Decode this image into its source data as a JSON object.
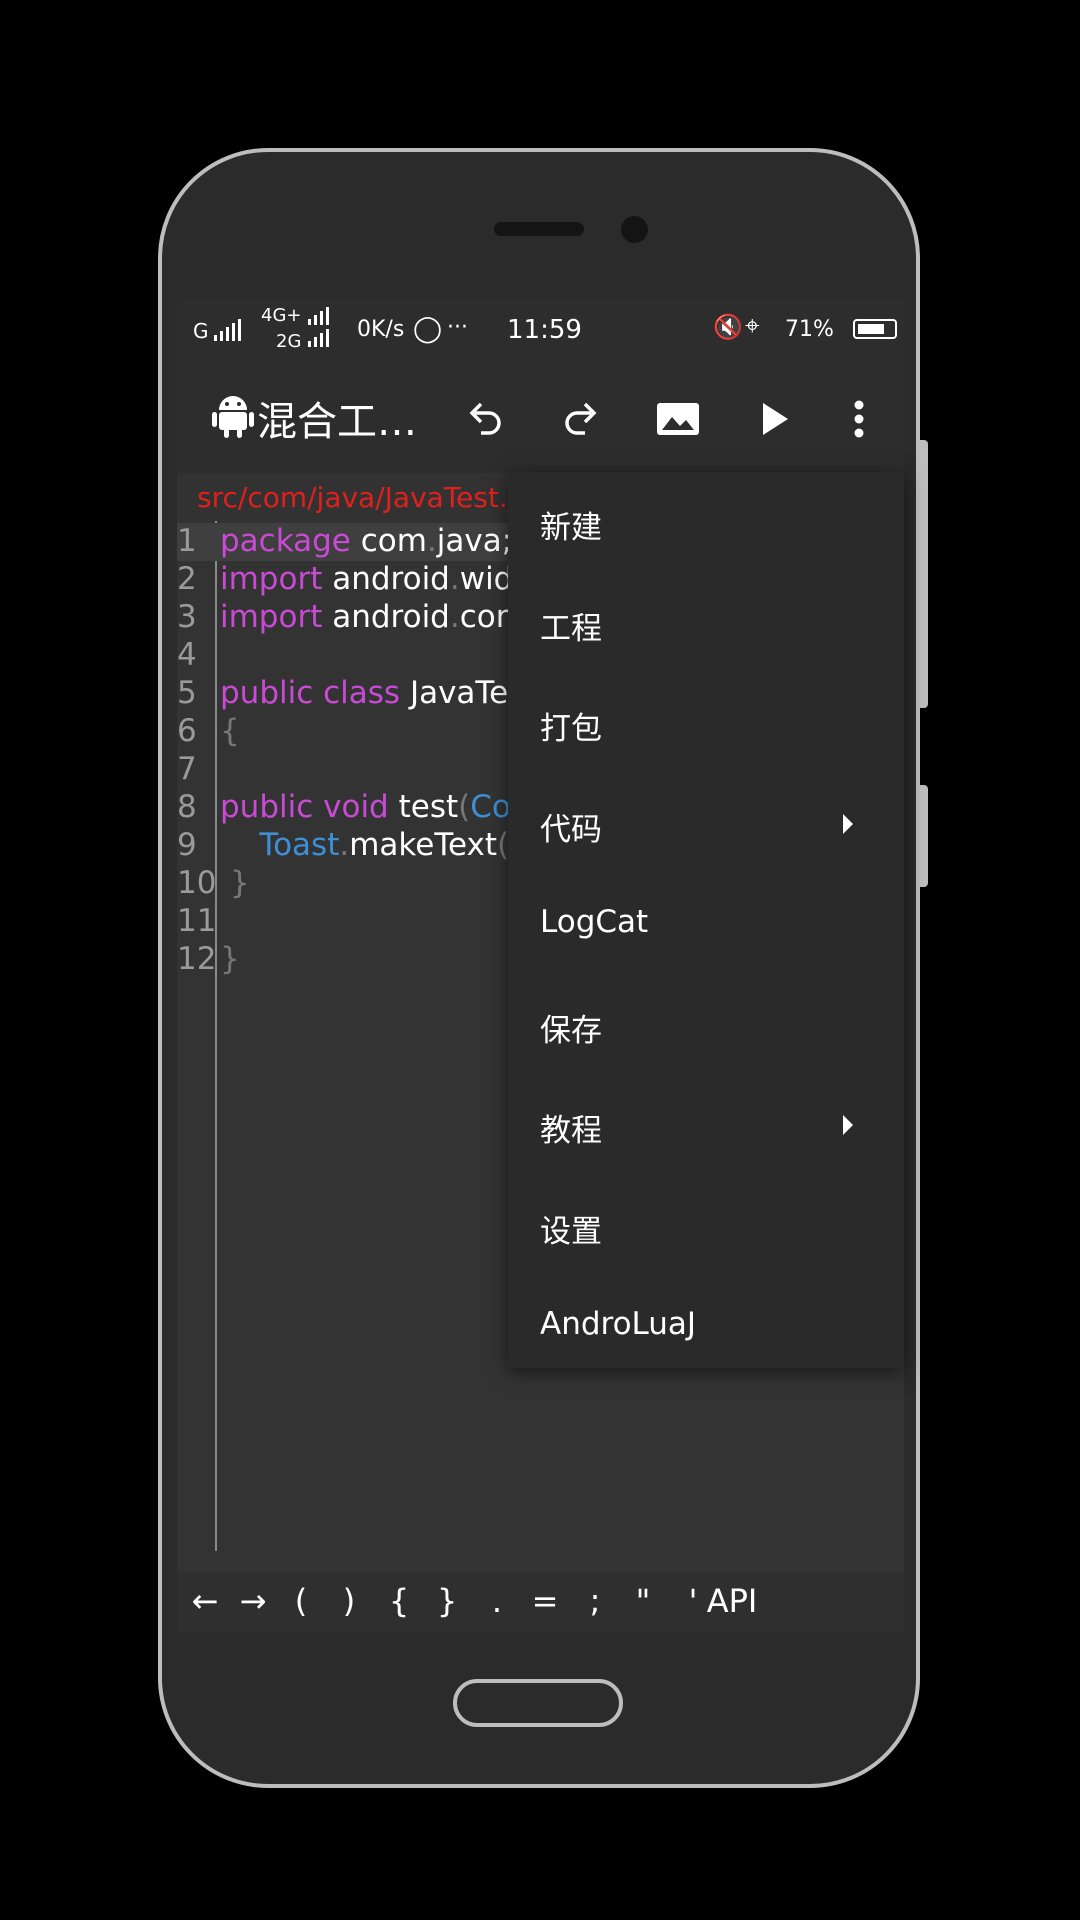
{
  "statusbar": {
    "carrier1": "G",
    "carrier2_top": "4G+",
    "carrier2_bottom": "2G",
    "net_speed": "0K/s",
    "more": "···",
    "time": "11:59",
    "battery": "71%"
  },
  "toolbar": {
    "title": "混合工…",
    "icons": [
      "android-icon",
      "undo-icon",
      "redo-icon",
      "image-icon",
      "run-icon",
      "more-vert-icon"
    ]
  },
  "path": "src/com/java/JavaTest.j",
  "code": [
    {
      "n": "1",
      "parts": [
        {
          "t": "package",
          "c": "kw"
        },
        {
          "t": " com"
        },
        {
          "t": ".",
          "c": "dim"
        },
        {
          "t": "java;"
        }
      ]
    },
    {
      "n": "2",
      "parts": [
        {
          "t": "import",
          "c": "kw"
        },
        {
          "t": " android"
        },
        {
          "t": ".",
          "c": "dim"
        },
        {
          "t": "widg"
        }
      ]
    },
    {
      "n": "3",
      "parts": [
        {
          "t": "import",
          "c": "kw"
        },
        {
          "t": " android"
        },
        {
          "t": ".",
          "c": "dim"
        },
        {
          "t": "cont"
        }
      ]
    },
    {
      "n": "4",
      "parts": []
    },
    {
      "n": "5",
      "parts": [
        {
          "t": "public class",
          "c": "kw"
        },
        {
          "t": " JavaTe"
        }
      ]
    },
    {
      "n": "6",
      "parts": [
        {
          "t": "{",
          "c": "dim"
        }
      ]
    },
    {
      "n": "7",
      "parts": []
    },
    {
      "n": "8",
      "parts": [
        {
          "t": "public void",
          "c": "kw"
        },
        {
          "t": " test"
        },
        {
          "t": "(",
          "c": "dim"
        },
        {
          "t": "Con",
          "c": "ty"
        }
      ]
    },
    {
      "n": "9",
      "parts": [
        {
          "t": "    "
        },
        {
          "t": "Toast",
          "c": "ty"
        },
        {
          "t": ".",
          "c": "dim"
        },
        {
          "t": "makeText"
        },
        {
          "t": "(c",
          "c": "dim"
        }
      ]
    },
    {
      "n": "10",
      "parts": [
        {
          "t": " }",
          "c": "dim"
        }
      ]
    },
    {
      "n": "11",
      "parts": []
    },
    {
      "n": "12",
      "parts": [
        {
          "t": "}",
          "c": "dim"
        }
      ]
    }
  ],
  "keys": [
    "←",
    "→",
    "(",
    ")",
    "{",
    "}",
    ".",
    "=",
    ";",
    "\"",
    "'",
    "API"
  ],
  "menu": {
    "items": [
      {
        "label": "新建",
        "submenu": false
      },
      {
        "label": "工程",
        "submenu": false
      },
      {
        "label": "打包",
        "submenu": false
      },
      {
        "label": "代码",
        "submenu": true
      },
      {
        "label": "LogCat",
        "submenu": false
      },
      {
        "label": "保存",
        "submenu": false
      },
      {
        "label": "教程",
        "submenu": true
      },
      {
        "label": "设置",
        "submenu": false
      },
      {
        "label": "AndroLuaJ",
        "submenu": false
      }
    ]
  }
}
